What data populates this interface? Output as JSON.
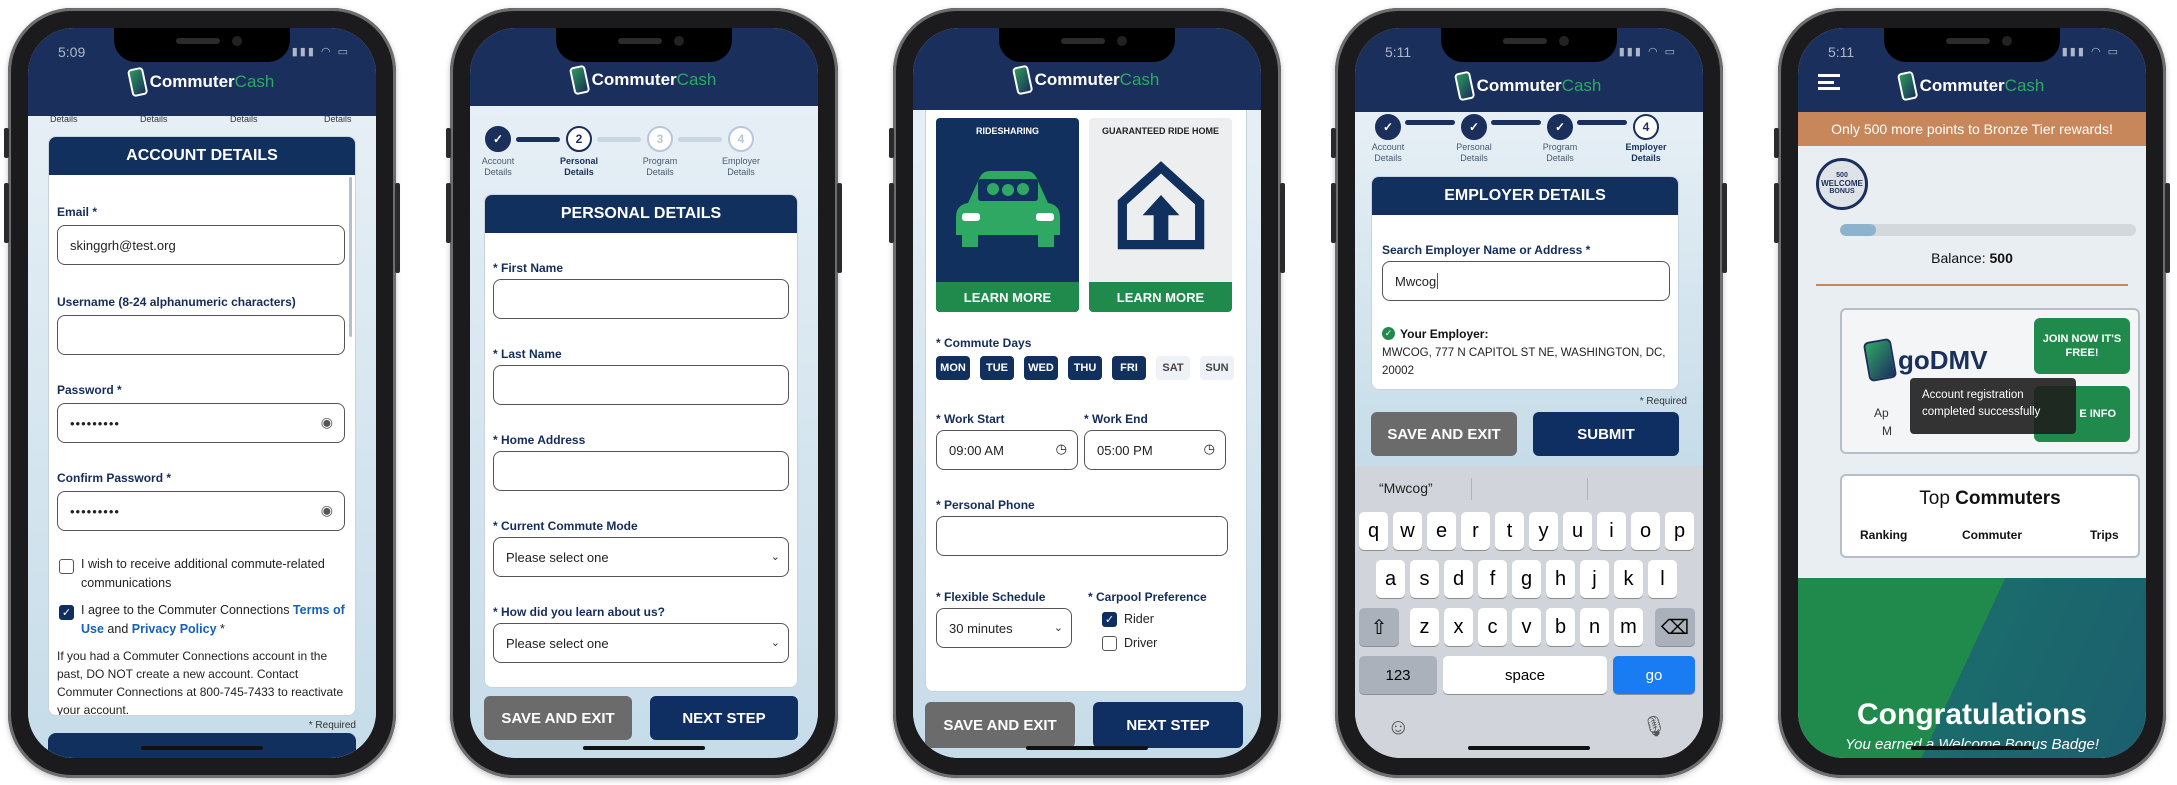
{
  "brand": {
    "part1": "Commuter",
    "part2": "Cash"
  },
  "required_note": "* Required",
  "phone1": {
    "time": "5:09",
    "top_steps": [
      "Details",
      "Details",
      "Details",
      "Details"
    ],
    "title": "ACCOUNT DETAILS",
    "email_label": "Email *",
    "email_value": "skinggrh@test.org",
    "username_label": "Username (8-24 alphanumeric characters)",
    "password_label": "Password *",
    "password_value": "•••••••••",
    "confirm_label": "Confirm Password *",
    "confirm_value": "•••••••••",
    "opt_in_text": "I wish to receive additional commute-related communications",
    "agree_prefix": "I agree to the Commuter Connections ",
    "terms_link": "Terms of Use",
    "agree_and": " and ",
    "privacy_link": "Privacy Policy",
    "agree_suffix": " *",
    "notice": "If you had a Commuter Connections account in the past, DO NOT create a new account. Contact Commuter Connections at 800-745-7433 to reactivate your account."
  },
  "phone2": {
    "steps": [
      {
        "num": "",
        "label": "Account Details"
      },
      {
        "num": "2",
        "label": "Personal Details"
      },
      {
        "num": "3",
        "label": "Program Details"
      },
      {
        "num": "4",
        "label": "Employer Details"
      }
    ],
    "title": "PERSONAL DETAILS",
    "first_name": "* First Name",
    "last_name": "* Last Name",
    "home_address": "* Home Address",
    "commute_mode": "* Current Commute Mode",
    "learn_about": "* How did you learn about us?",
    "select_placeholder": "Please select one",
    "save_exit": "SAVE AND EXIT",
    "next_step": "NEXT STEP"
  },
  "phone3": {
    "tile1_title": "RIDESHARING",
    "tile2_title": "GUARANTEED RIDE HOME",
    "learn_more": "LEARN MORE",
    "commute_days_label": "* Commute Days",
    "days": [
      "MON",
      "TUE",
      "WED",
      "THU",
      "FRI",
      "SAT",
      "SUN"
    ],
    "work_start_label": "* Work Start",
    "work_start": "09:00 AM",
    "work_end_label": "* Work End",
    "work_end": "05:00 PM",
    "personal_phone_label": "* Personal Phone",
    "flex_label": "* Flexible Schedule",
    "flex_value": "30 minutes",
    "carpool_label": "* Carpool Preference",
    "rider": "Rider",
    "driver": "Driver",
    "save_exit": "SAVE AND EXIT",
    "next_step": "NEXT STEP"
  },
  "phone4": {
    "time": "5:11",
    "steps": [
      {
        "num": "",
        "label": "Account Details"
      },
      {
        "num": "",
        "label": "Personal Details"
      },
      {
        "num": "",
        "label": "Program Details"
      },
      {
        "num": "4",
        "label": "Employer Details"
      }
    ],
    "title": "EMPLOYER DETAILS",
    "search_label": "Search Employer Name or Address *",
    "search_value": "Mwcog",
    "your_employer_label": "Your Employer:",
    "employer_value": "MWCOG, 777 N CAPITOL ST NE, WASHINGTON, DC, 20002",
    "save_exit": "SAVE AND EXIT",
    "submit": "SUBMIT",
    "suggestion": "“Mwcog”",
    "row1": [
      "q",
      "w",
      "e",
      "r",
      "t",
      "y",
      "u",
      "i",
      "o",
      "p"
    ],
    "row2": [
      "a",
      "s",
      "d",
      "f",
      "g",
      "h",
      "j",
      "k",
      "l"
    ],
    "row3": [
      "z",
      "x",
      "c",
      "v",
      "b",
      "n",
      "m"
    ],
    "key_123": "123",
    "key_space": "space",
    "key_go": "go"
  },
  "phone5": {
    "time": "5:11",
    "banner": "Only 500 more points to Bronze Tier rewards!",
    "badge_top": "500",
    "badge_mid": "WELCOME",
    "badge_bot": "BONUS",
    "balance_label": "Balance: ",
    "balance_value": "500",
    "progress": 0.12,
    "promo_brand": "goDMV",
    "promo_side_1": "Ap",
    "promo_side_2": "M",
    "join_now": "JOIN NOW IT'S FREE!",
    "more_info": "E INFO",
    "toast": "Account registration completed successfully",
    "top_label_1": "Top ",
    "top_label_2": "Commuters",
    "col_ranking": "Ranking",
    "col_commuter": "Commuter",
    "col_trips": "Trips",
    "congrats": "Congratulations",
    "congrats_sub": "You earned a Welcome Bonus Badge!"
  },
  "colors": {
    "navy": "#12305e",
    "green": "#1f8a4c",
    "orange": "#c7875a"
  }
}
